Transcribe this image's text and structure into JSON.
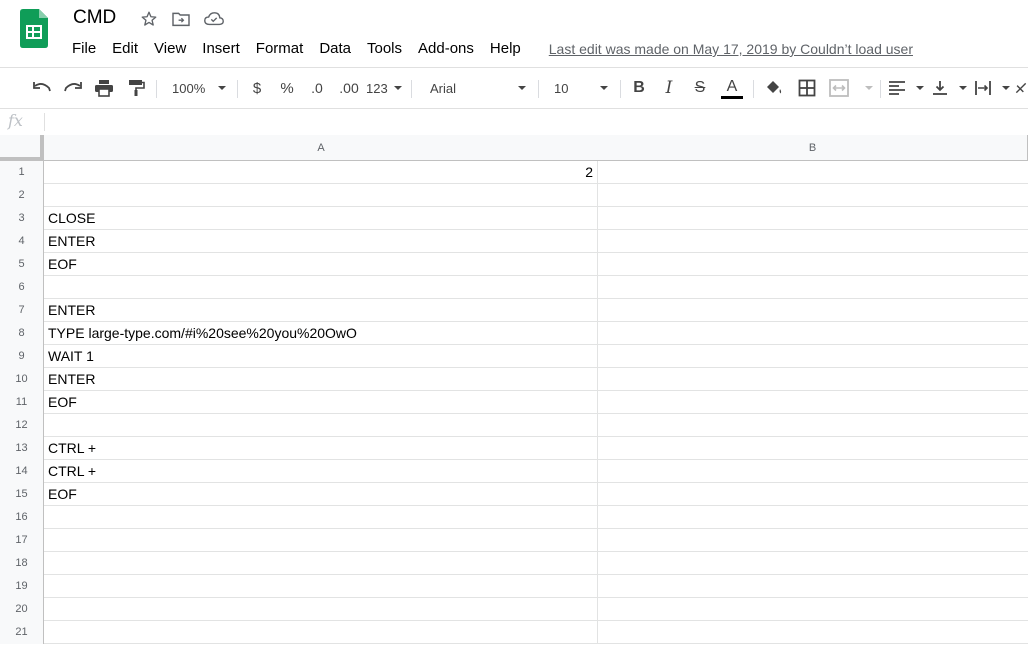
{
  "app": {
    "title": "CMD",
    "last_edit": "Last edit was made on May 17, 2019 by Couldn’t load user"
  },
  "menu": [
    "File",
    "Edit",
    "View",
    "Insert",
    "Format",
    "Data",
    "Tools",
    "Add-ons",
    "Help"
  ],
  "toolbar": {
    "zoom": "100%",
    "currency": "$",
    "percent": "%",
    "decrease_decimal": ".0",
    "increase_decimal": ".00",
    "more_formats": "123",
    "font": "Arial",
    "font_size": "10",
    "bold": "B",
    "italic": "I",
    "strikethrough": "S",
    "text_color": "A"
  },
  "formula_bar": {
    "fx": "fx",
    "value": ""
  },
  "columns": [
    "A",
    "B"
  ],
  "rows": [
    {
      "n": "1",
      "a": "2",
      "align": "right"
    },
    {
      "n": "2",
      "a": ""
    },
    {
      "n": "3",
      "a": "CLOSE"
    },
    {
      "n": "4",
      "a": "ENTER"
    },
    {
      "n": "5",
      "a": "EOF"
    },
    {
      "n": "6",
      "a": ""
    },
    {
      "n": "7",
      "a": "ENTER"
    },
    {
      "n": "8",
      "a": "TYPE large-type.com/#i%20see%20you%20OwO"
    },
    {
      "n": "9",
      "a": "WAIT 1"
    },
    {
      "n": "10",
      "a": "ENTER"
    },
    {
      "n": "11",
      "a": "EOF"
    },
    {
      "n": "12",
      "a": ""
    },
    {
      "n": "13",
      "a": "CTRL +"
    },
    {
      "n": "14",
      "a": "CTRL +"
    },
    {
      "n": "15",
      "a": "EOF"
    },
    {
      "n": "16",
      "a": ""
    },
    {
      "n": "17",
      "a": ""
    },
    {
      "n": "18",
      "a": ""
    },
    {
      "n": "19",
      "a": ""
    },
    {
      "n": "20",
      "a": ""
    },
    {
      "n": "21",
      "a": ""
    }
  ],
  "colors": {
    "sheets_green": "#0f9d58",
    "text_color_bar": "#000000"
  }
}
